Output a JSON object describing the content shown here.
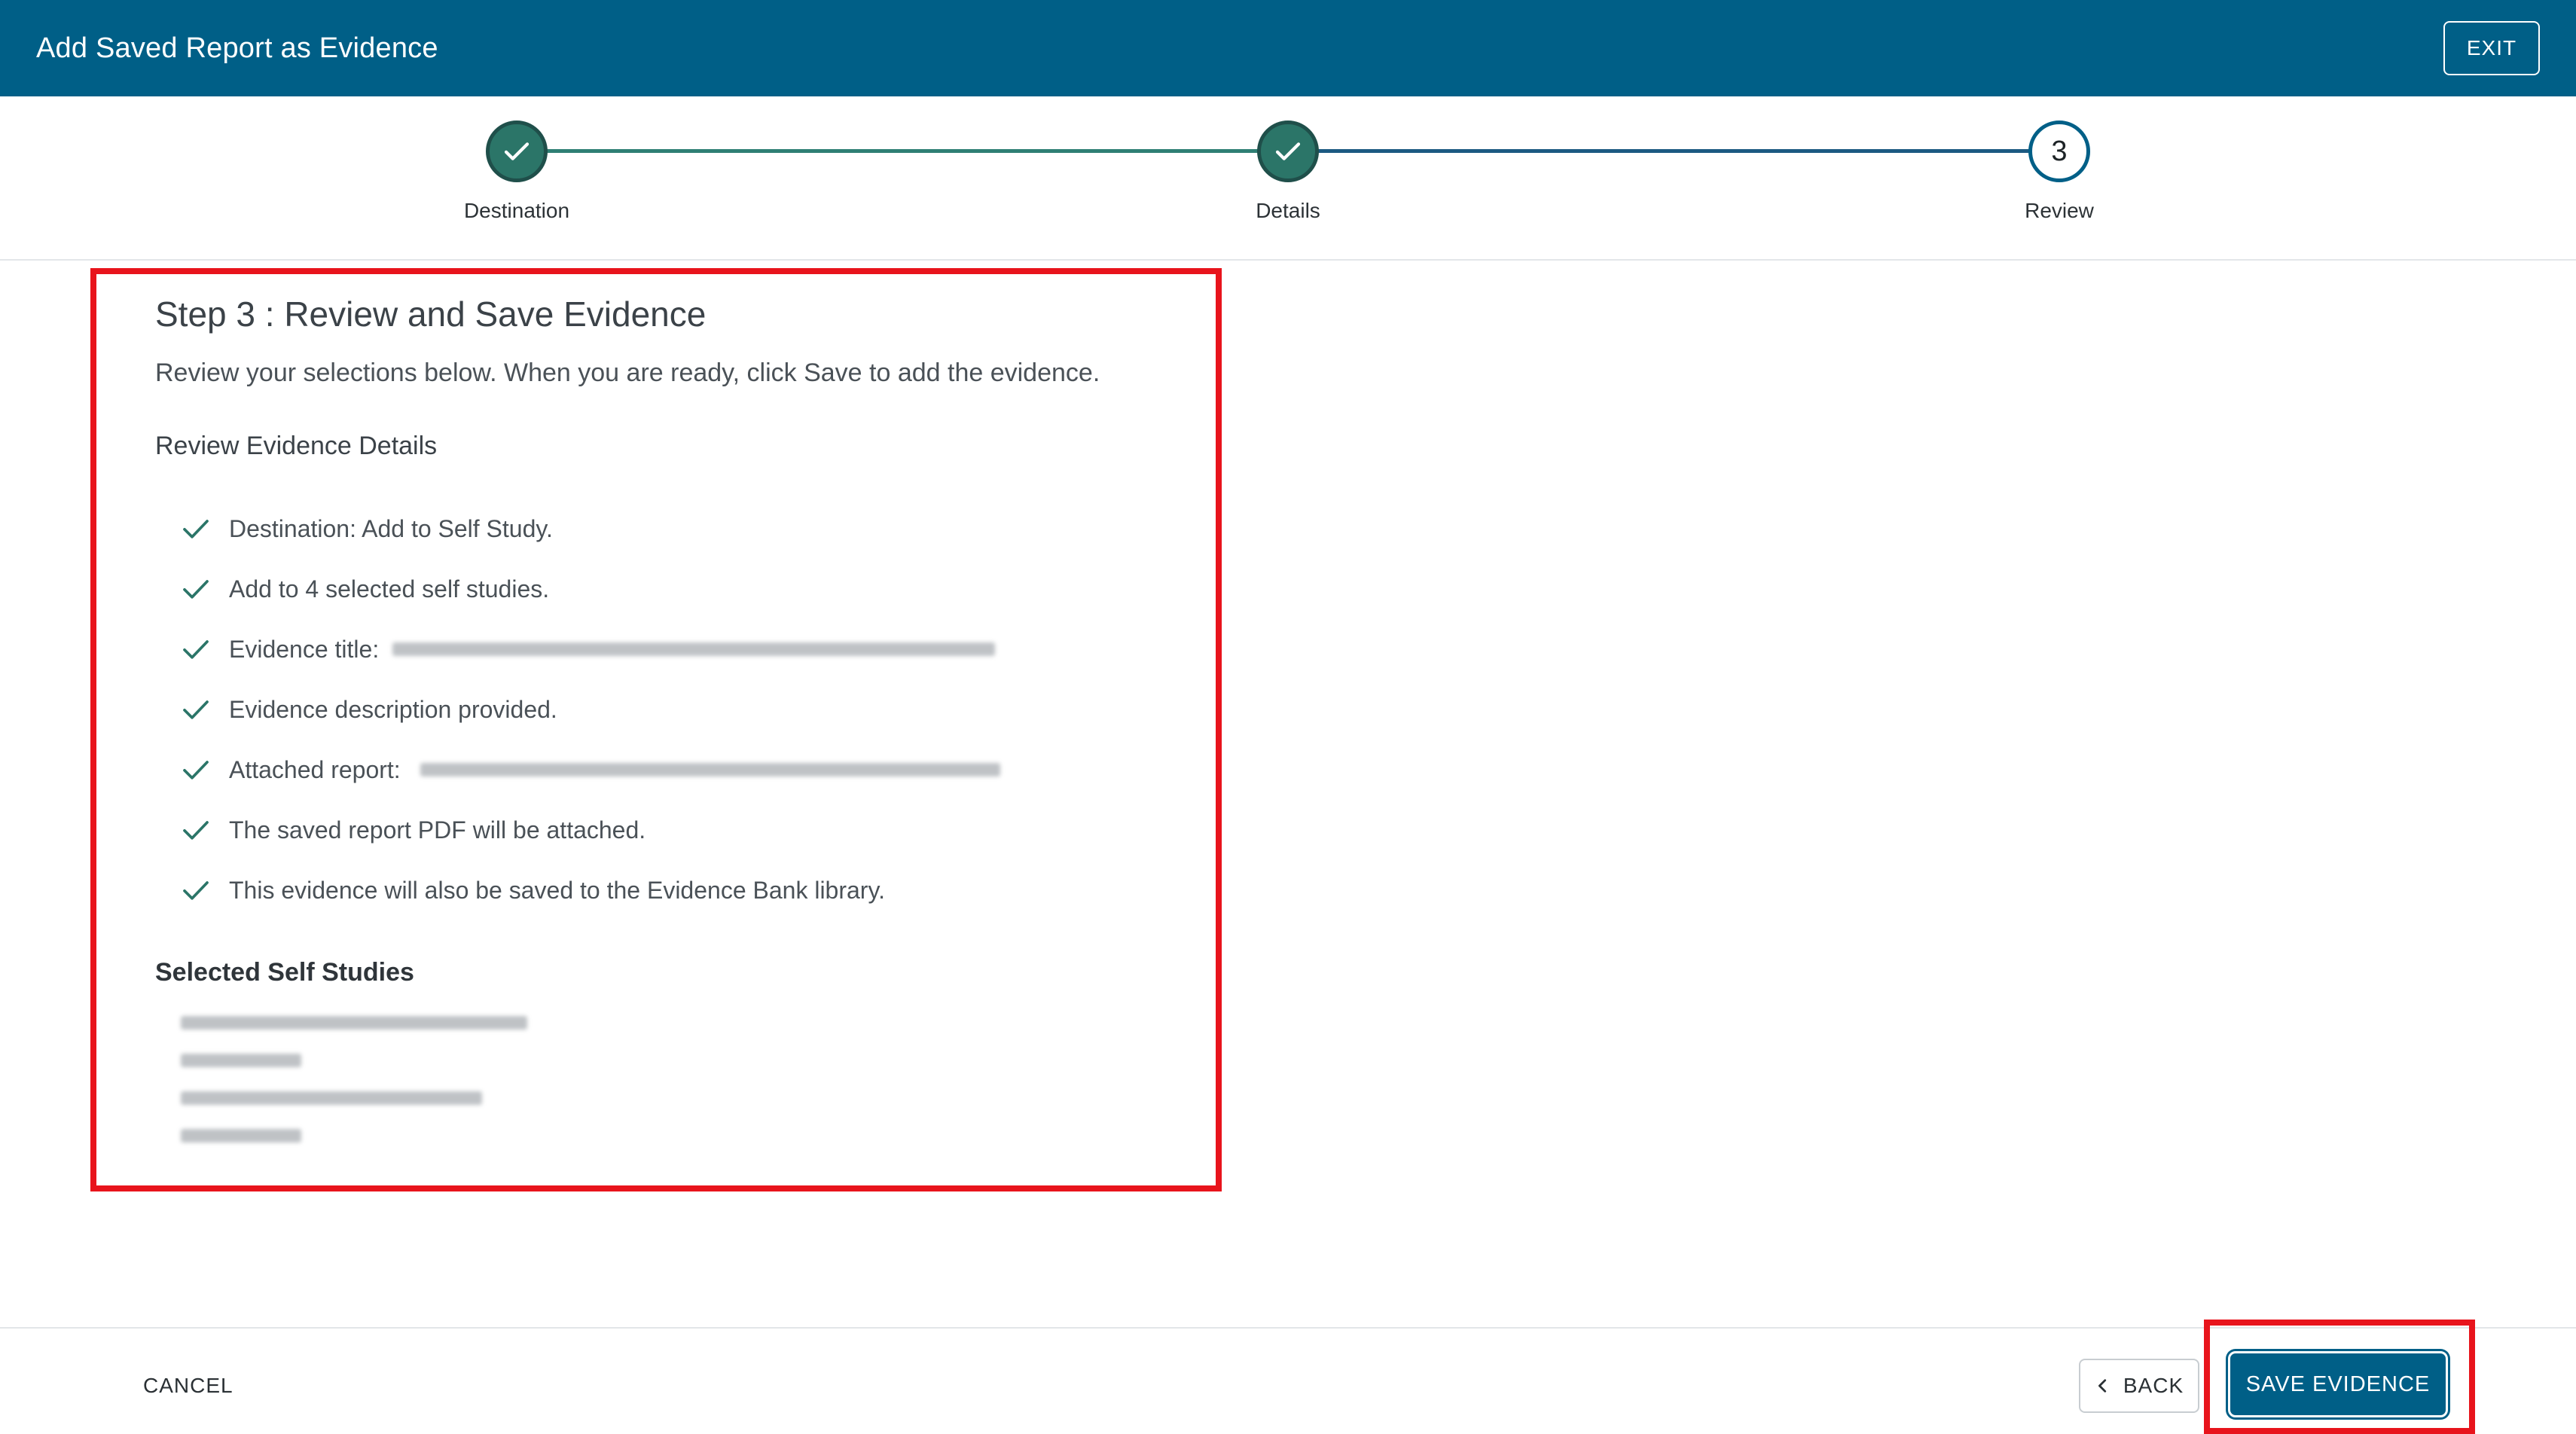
{
  "header": {
    "title": "Add Saved Report as Evidence",
    "exit_label": "EXIT"
  },
  "stepper": {
    "steps": [
      {
        "label": "Destination",
        "status": "complete"
      },
      {
        "label": "Details",
        "status": "complete"
      },
      {
        "label": "Review",
        "status": "current",
        "number": "3"
      }
    ]
  },
  "review": {
    "heading": "Step 3 : Review and Save Evidence",
    "intro": "Review your selections below. When you are ready, click Save to add the evidence.",
    "details_heading": "Review Evidence Details",
    "items": [
      "Destination: Add to Self Study.",
      "Add to 4 selected self studies.",
      "Evidence title:",
      "Evidence description provided.",
      "Attached report:",
      "The saved report PDF will be attached.",
      "This evidence will also be saved to the Evidence Bank library."
    ],
    "selected_heading": "Selected Self Studies"
  },
  "footer": {
    "cancel_label": "CANCEL",
    "back_label": "BACK",
    "save_label": "SAVE EVIDENCE"
  },
  "colors": {
    "header_bg": "#005f87",
    "step_done": "#2b7568",
    "highlight": "#e8141c",
    "check": "#2b7568"
  },
  "icons": {
    "check": "check-icon",
    "back": "chevron-left-icon"
  }
}
